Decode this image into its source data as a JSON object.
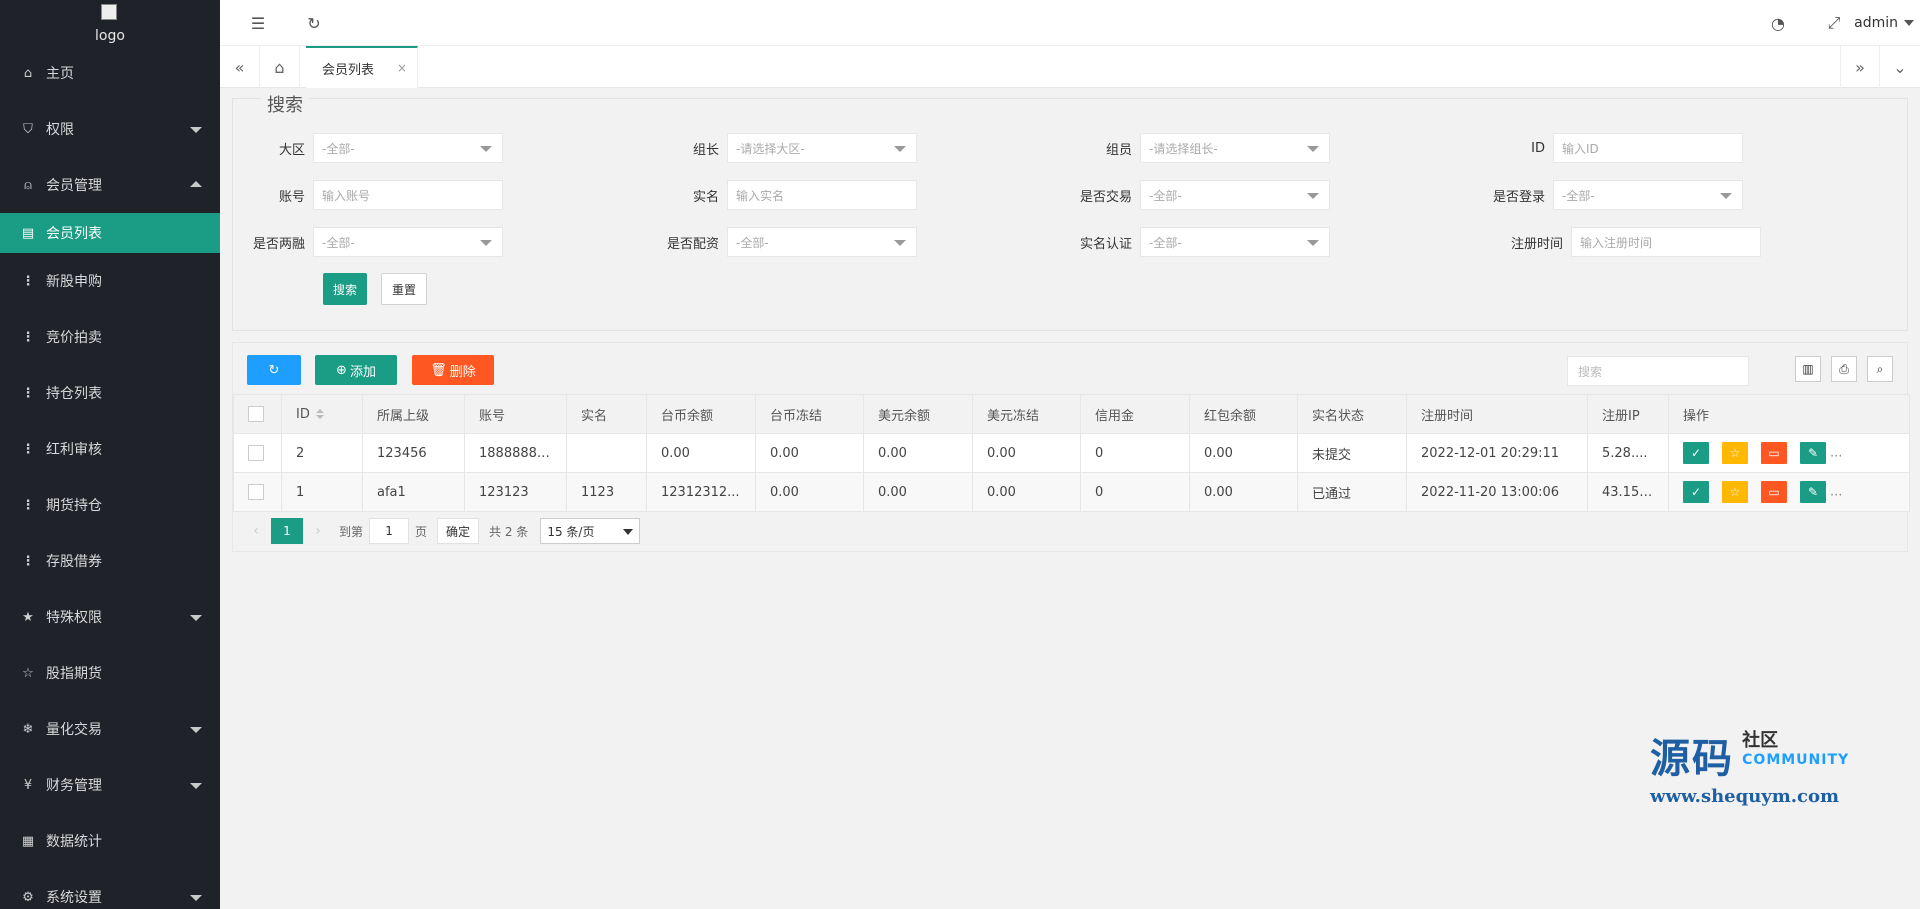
{
  "sidebar": {
    "logo_alt": "logo",
    "items": [
      {
        "label": "主页",
        "icon": "home-icon"
      },
      {
        "label": "权限",
        "icon": "shield-icon"
      },
      {
        "label": "会员管理",
        "icon": "user-icon"
      },
      {
        "label": "会员列表",
        "icon": "doc-icon"
      },
      {
        "label": "新股申购",
        "icon": "dots-icon"
      },
      {
        "label": "竞价拍卖",
        "icon": "dots-icon"
      },
      {
        "label": "持仓列表",
        "icon": "dots-icon"
      },
      {
        "label": "红利审核",
        "icon": "dots-icon"
      },
      {
        "label": "期货持仓",
        "icon": "dots-icon"
      },
      {
        "label": "存股借券",
        "icon": "dots-icon"
      },
      {
        "label": "特殊权限",
        "icon": "star-icon"
      },
      {
        "label": "股指期货",
        "icon": "star-outline-icon"
      },
      {
        "label": "量化交易",
        "icon": "snowflake-icon"
      },
      {
        "label": "财务管理",
        "icon": "money-icon"
      },
      {
        "label": "数据统计",
        "icon": "calendar-icon"
      },
      {
        "label": "系统设置",
        "icon": "gear-icon"
      }
    ]
  },
  "header": {
    "admin": "admin"
  },
  "tabs": {
    "active": "会员列表",
    "close": "×"
  },
  "search": {
    "legend": "搜索",
    "fields": {
      "daqu": {
        "label": "大区",
        "placeholder": "-全部-"
      },
      "zuzhang": {
        "label": "组长",
        "placeholder": "-请选择大区-"
      },
      "zuyuan": {
        "label": "组员",
        "placeholder": "-请选择组长-"
      },
      "id": {
        "label": "ID",
        "placeholder": "输入ID"
      },
      "account": {
        "label": "账号",
        "placeholder": "输入账号"
      },
      "realname": {
        "label": "实名",
        "placeholder": "输入实名"
      },
      "trade": {
        "label": "是否交易",
        "placeholder": "-全部-"
      },
      "login": {
        "label": "是否登录",
        "placeholder": "-全部-"
      },
      "margin": {
        "label": "是否两融",
        "placeholder": "-全部-"
      },
      "funding": {
        "label": "是否配资",
        "placeholder": "-全部-"
      },
      "verify": {
        "label": "实名认证",
        "placeholder": "-全部-"
      },
      "regtime": {
        "label": "注册时间",
        "placeholder": "输入注册时间"
      }
    },
    "search_btn": "搜索",
    "reset_btn": "重置"
  },
  "toolbar": {
    "add": "添加",
    "delete": "删除",
    "search_placeholder": "搜索"
  },
  "table": {
    "headers": [
      "ID",
      "所属上级",
      "账号",
      "实名",
      "台币余额",
      "台币冻结",
      "美元余额",
      "美元冻结",
      "信用金",
      "红包余额",
      "实名状态",
      "注册时间",
      "注册IP",
      "操作"
    ],
    "rows": [
      [
        "2",
        "123456",
        "18888888...",
        "",
        "0.00",
        "0.00",
        "0.00",
        "0.00",
        "0",
        "0.00",
        "未提交",
        "2022-12-01 20:29:11",
        "5.28...."
      ],
      [
        "1",
        "afa1",
        "123123",
        "1123",
        "12312312...",
        "0.00",
        "0.00",
        "0.00",
        "0",
        "0.00",
        "已通过",
        "2022-11-20 13:00:06",
        "43.15...."
      ]
    ],
    "more": "..."
  },
  "pager": {
    "current": "1",
    "goto": "到第",
    "page_input": "1",
    "page_unit": "页",
    "ok": "确定",
    "total": "共 2 条",
    "size": "15 条/页"
  },
  "watermark": {
    "big": "源码",
    "small": "社区",
    "community": "COMMUNITY",
    "url": "www.shequym.com"
  },
  "colors": {
    "sidebar_bg": "#20222a",
    "accent": "#1a9c85",
    "blue": "#1e9fff",
    "orange": "#ff5722",
    "yellow": "#ffb800"
  }
}
